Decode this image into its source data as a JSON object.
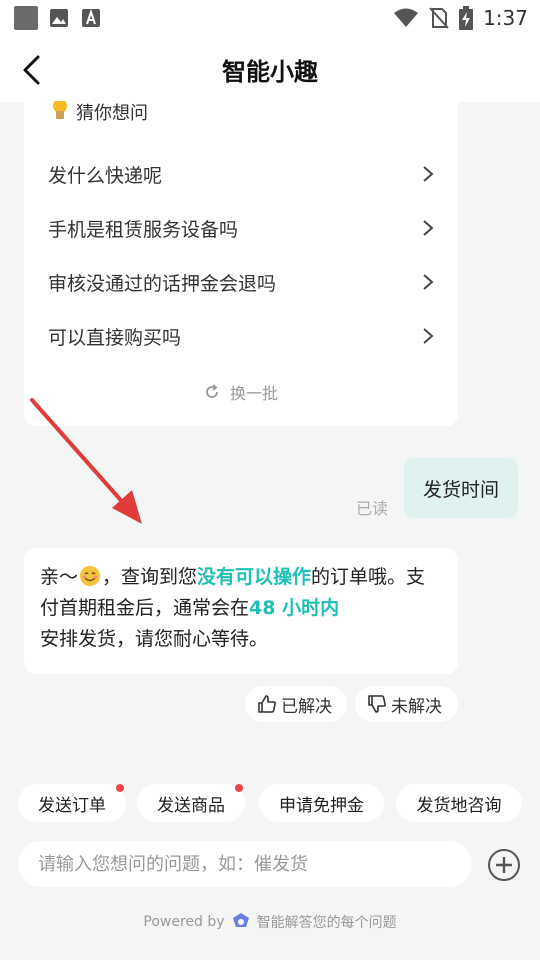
{
  "status_bar": {
    "time": "1:37",
    "left_icons": [
      "notification-square-icon",
      "image-icon",
      "font-icon"
    ],
    "right_icons": [
      "wifi-icon",
      "no-sim-icon",
      "battery-charging-icon"
    ]
  },
  "header": {
    "title": "智能小趣"
  },
  "suggestions": {
    "title": "猜你想问",
    "items": [
      {
        "label": "发什么快递呢"
      },
      {
        "label": "手机是租赁服务设备吗"
      },
      {
        "label": "审核没通过的话押金会退吗"
      },
      {
        "label": "可以直接购买吗"
      }
    ],
    "refresh_label": "换一批"
  },
  "messages": {
    "user_text": "发货时间",
    "read_status": "已读",
    "bot": {
      "p1": "亲〜",
      "p2": "，查询到您",
      "h1": "没有可以操作",
      "p3": "的订单哦。支付首期租金后，通常会在",
      "h2": "48 小时内",
      "p4": "安排发货，请您耐心等待。"
    }
  },
  "feedback": {
    "solved": "已解决",
    "unsolved": "未解决"
  },
  "quick_actions": [
    {
      "label": "发送订单",
      "badge": true
    },
    {
      "label": "发送商品",
      "badge": true
    },
    {
      "label": "申请免押金",
      "badge": false
    },
    {
      "label": "发货地咨询",
      "badge": false
    }
  ],
  "input": {
    "placeholder": "请输入您想问的问题，如：催发货"
  },
  "footer": {
    "powered_by": "Powered by",
    "tagline": "智能解答您的每个问题"
  },
  "colors": {
    "accent": "#1ec0b6",
    "badge": "#f0454a",
    "annotation_arrow": "#e03c3c"
  }
}
